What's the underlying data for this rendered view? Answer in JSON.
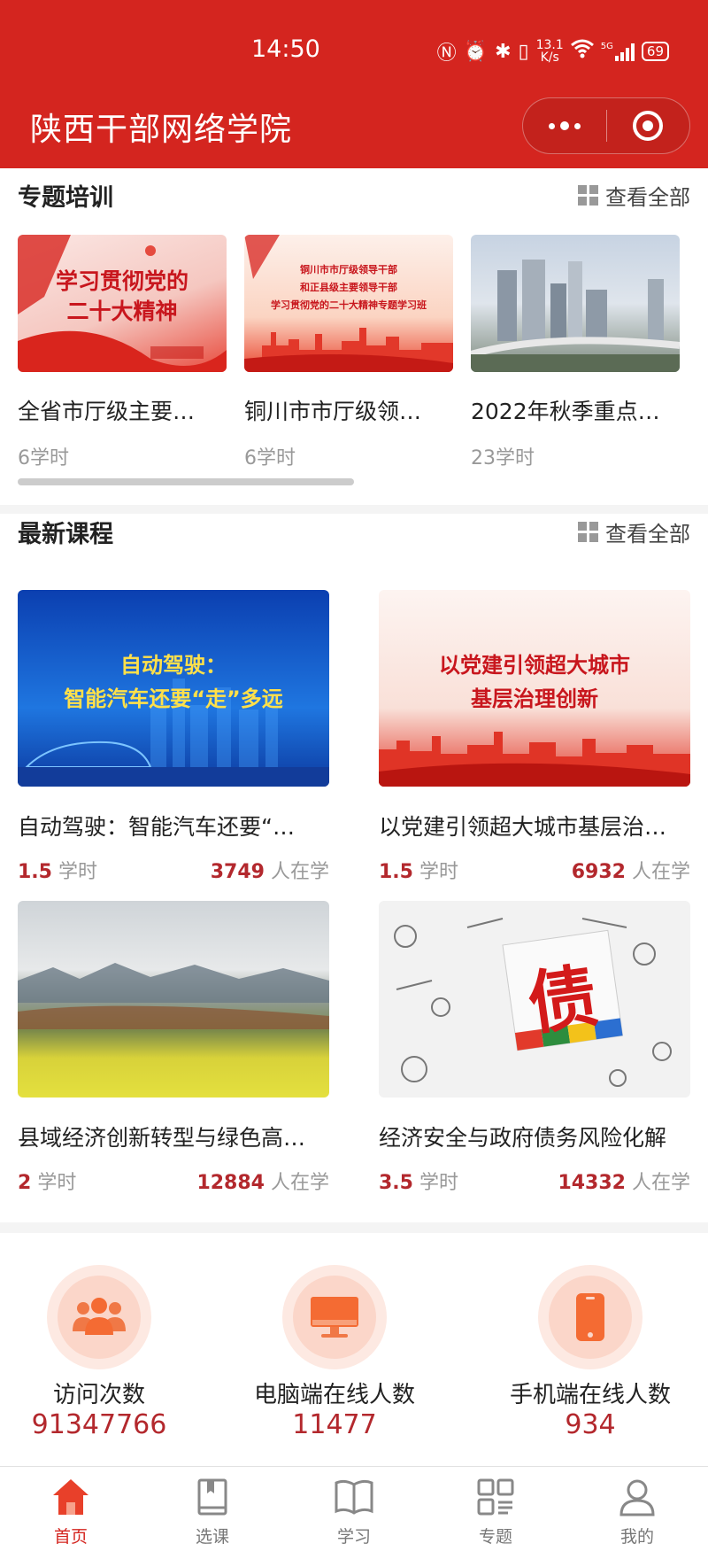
{
  "status_bar": {
    "time": "14:50",
    "net_speed_value": "13.1",
    "net_speed_unit": "K/s",
    "network": "5G",
    "battery": "69"
  },
  "header": {
    "title": "陕西干部网络学院"
  },
  "topics": {
    "title": "专题培训",
    "view_all": "查看全部",
    "items": [
      {
        "banner_line1": "学习贯彻党的",
        "banner_line2": "二十大精神",
        "title": "全省市厅级主要…",
        "hours": "6学时"
      },
      {
        "banner_line1": "铜川市市厅级领导干部",
        "banner_line2": "和正县级主要领导干部",
        "banner_line3": "学习贯彻党的二十大精神专题学习班",
        "title": "铜川市市厅级领…",
        "hours": "6学时"
      },
      {
        "title": "2022年秋季重点…",
        "hours": "23学时"
      }
    ]
  },
  "courses": {
    "title": "最新课程",
    "view_all": "查看全部",
    "items": [
      {
        "banner_line1": "自动驾驶：",
        "banner_line2": "智能汽车还要“走”多远",
        "title": "自动驾驶：智能汽车还要“…",
        "hours_value": "1.5",
        "hours_unit": "学时",
        "learners_value": "3749",
        "learners_unit": "人在学"
      },
      {
        "banner_line1": "以党建引领超大城市",
        "banner_line2": "基层治理创新",
        "title": "以党建引领超大城市基层治…",
        "hours_value": "1.5",
        "hours_unit": "学时",
        "learners_value": "6932",
        "learners_unit": "人在学"
      },
      {
        "title": "县域经济创新转型与绿色高…",
        "hours_value": "2",
        "hours_unit": "学时",
        "learners_value": "12884",
        "learners_unit": "人在学"
      },
      {
        "banner_char": "债",
        "title": "经济安全与政府债务风险化解",
        "hours_value": "3.5",
        "hours_unit": "学时",
        "learners_value": "14332",
        "learners_unit": "人在学"
      }
    ]
  },
  "stats": [
    {
      "icon": "people-icon",
      "label": "访问次数",
      "value": "91347766"
    },
    {
      "icon": "monitor-icon",
      "label": "电脑端在线人数",
      "value": "11477"
    },
    {
      "icon": "phone-icon",
      "label": "手机端在线人数",
      "value": "934"
    }
  ],
  "tabbar": [
    {
      "icon": "home-icon",
      "label": "首页",
      "active": true
    },
    {
      "icon": "book-icon",
      "label": "选课"
    },
    {
      "icon": "open-book-icon",
      "label": "学习"
    },
    {
      "icon": "grid-list-icon",
      "label": "专题"
    },
    {
      "icon": "user-icon",
      "label": "我的"
    }
  ],
  "colors": {
    "brand_red": "#d4251f",
    "number_red": "#b3282d",
    "muted": "#999999"
  }
}
